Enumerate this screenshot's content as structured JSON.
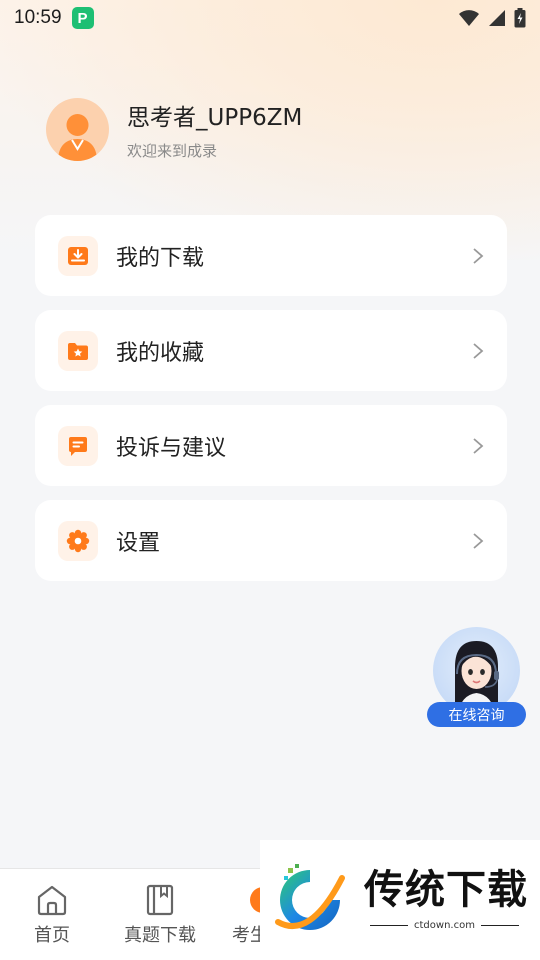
{
  "status_bar": {
    "time": "10:59",
    "app_badge": "P"
  },
  "profile": {
    "username": "思考者_UPP6ZM",
    "welcome": "欢迎来到成录"
  },
  "menu": [
    {
      "label": "我的下载",
      "icon": "download-box-icon"
    },
    {
      "label": "我的收藏",
      "icon": "star-folder-icon"
    },
    {
      "label": "投诉与建议",
      "icon": "feedback-icon"
    },
    {
      "label": "设置",
      "icon": "gear-icon"
    }
  ],
  "consult": {
    "label": "在线咨询"
  },
  "tabbar": {
    "tabs": [
      {
        "label": "首页",
        "icon": "home-icon"
      },
      {
        "label": "真题下载",
        "icon": "book-icon"
      },
      {
        "label": "考生",
        "icon": "exam-icon"
      }
    ]
  },
  "watermark": {
    "title": "传统下载",
    "domain": "ctdown.com"
  },
  "colors": {
    "accent": "#ff7a1a",
    "consult_blue": "#2f6fe4",
    "background": "#f5f6f8"
  }
}
